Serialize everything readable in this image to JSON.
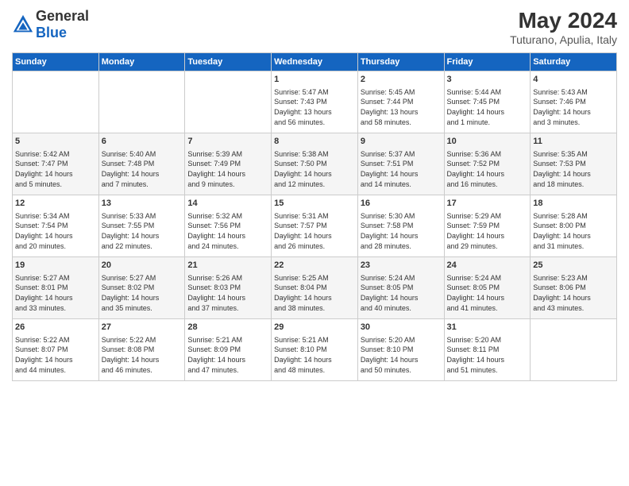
{
  "header": {
    "logo_general": "General",
    "logo_blue": "Blue",
    "title": "May 2024",
    "subtitle": "Tuturano, Apulia, Italy"
  },
  "weekdays": [
    "Sunday",
    "Monday",
    "Tuesday",
    "Wednesday",
    "Thursday",
    "Friday",
    "Saturday"
  ],
  "weeks": [
    [
      {
        "day": "",
        "info": ""
      },
      {
        "day": "",
        "info": ""
      },
      {
        "day": "",
        "info": ""
      },
      {
        "day": "1",
        "info": "Sunrise: 5:47 AM\nSunset: 7:43 PM\nDaylight: 13 hours\nand 56 minutes."
      },
      {
        "day": "2",
        "info": "Sunrise: 5:45 AM\nSunset: 7:44 PM\nDaylight: 13 hours\nand 58 minutes."
      },
      {
        "day": "3",
        "info": "Sunrise: 5:44 AM\nSunset: 7:45 PM\nDaylight: 14 hours\nand 1 minute."
      },
      {
        "day": "4",
        "info": "Sunrise: 5:43 AM\nSunset: 7:46 PM\nDaylight: 14 hours\nand 3 minutes."
      }
    ],
    [
      {
        "day": "5",
        "info": "Sunrise: 5:42 AM\nSunset: 7:47 PM\nDaylight: 14 hours\nand 5 minutes."
      },
      {
        "day": "6",
        "info": "Sunrise: 5:40 AM\nSunset: 7:48 PM\nDaylight: 14 hours\nand 7 minutes."
      },
      {
        "day": "7",
        "info": "Sunrise: 5:39 AM\nSunset: 7:49 PM\nDaylight: 14 hours\nand 9 minutes."
      },
      {
        "day": "8",
        "info": "Sunrise: 5:38 AM\nSunset: 7:50 PM\nDaylight: 14 hours\nand 12 minutes."
      },
      {
        "day": "9",
        "info": "Sunrise: 5:37 AM\nSunset: 7:51 PM\nDaylight: 14 hours\nand 14 minutes."
      },
      {
        "day": "10",
        "info": "Sunrise: 5:36 AM\nSunset: 7:52 PM\nDaylight: 14 hours\nand 16 minutes."
      },
      {
        "day": "11",
        "info": "Sunrise: 5:35 AM\nSunset: 7:53 PM\nDaylight: 14 hours\nand 18 minutes."
      }
    ],
    [
      {
        "day": "12",
        "info": "Sunrise: 5:34 AM\nSunset: 7:54 PM\nDaylight: 14 hours\nand 20 minutes."
      },
      {
        "day": "13",
        "info": "Sunrise: 5:33 AM\nSunset: 7:55 PM\nDaylight: 14 hours\nand 22 minutes."
      },
      {
        "day": "14",
        "info": "Sunrise: 5:32 AM\nSunset: 7:56 PM\nDaylight: 14 hours\nand 24 minutes."
      },
      {
        "day": "15",
        "info": "Sunrise: 5:31 AM\nSunset: 7:57 PM\nDaylight: 14 hours\nand 26 minutes."
      },
      {
        "day": "16",
        "info": "Sunrise: 5:30 AM\nSunset: 7:58 PM\nDaylight: 14 hours\nand 28 minutes."
      },
      {
        "day": "17",
        "info": "Sunrise: 5:29 AM\nSunset: 7:59 PM\nDaylight: 14 hours\nand 29 minutes."
      },
      {
        "day": "18",
        "info": "Sunrise: 5:28 AM\nSunset: 8:00 PM\nDaylight: 14 hours\nand 31 minutes."
      }
    ],
    [
      {
        "day": "19",
        "info": "Sunrise: 5:27 AM\nSunset: 8:01 PM\nDaylight: 14 hours\nand 33 minutes."
      },
      {
        "day": "20",
        "info": "Sunrise: 5:27 AM\nSunset: 8:02 PM\nDaylight: 14 hours\nand 35 minutes."
      },
      {
        "day": "21",
        "info": "Sunrise: 5:26 AM\nSunset: 8:03 PM\nDaylight: 14 hours\nand 37 minutes."
      },
      {
        "day": "22",
        "info": "Sunrise: 5:25 AM\nSunset: 8:04 PM\nDaylight: 14 hours\nand 38 minutes."
      },
      {
        "day": "23",
        "info": "Sunrise: 5:24 AM\nSunset: 8:05 PM\nDaylight: 14 hours\nand 40 minutes."
      },
      {
        "day": "24",
        "info": "Sunrise: 5:24 AM\nSunset: 8:05 PM\nDaylight: 14 hours\nand 41 minutes."
      },
      {
        "day": "25",
        "info": "Sunrise: 5:23 AM\nSunset: 8:06 PM\nDaylight: 14 hours\nand 43 minutes."
      }
    ],
    [
      {
        "day": "26",
        "info": "Sunrise: 5:22 AM\nSunset: 8:07 PM\nDaylight: 14 hours\nand 44 minutes."
      },
      {
        "day": "27",
        "info": "Sunrise: 5:22 AM\nSunset: 8:08 PM\nDaylight: 14 hours\nand 46 minutes."
      },
      {
        "day": "28",
        "info": "Sunrise: 5:21 AM\nSunset: 8:09 PM\nDaylight: 14 hours\nand 47 minutes."
      },
      {
        "day": "29",
        "info": "Sunrise: 5:21 AM\nSunset: 8:10 PM\nDaylight: 14 hours\nand 48 minutes."
      },
      {
        "day": "30",
        "info": "Sunrise: 5:20 AM\nSunset: 8:10 PM\nDaylight: 14 hours\nand 50 minutes."
      },
      {
        "day": "31",
        "info": "Sunrise: 5:20 AM\nSunset: 8:11 PM\nDaylight: 14 hours\nand 51 minutes."
      },
      {
        "day": "",
        "info": ""
      }
    ]
  ]
}
